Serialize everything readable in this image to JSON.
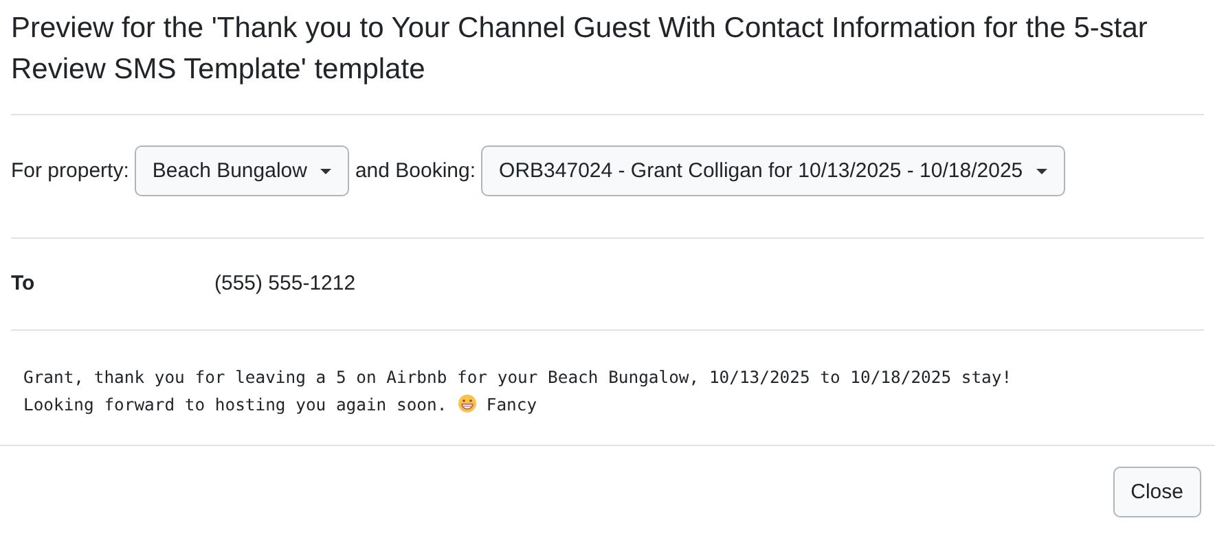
{
  "title": "Preview for the 'Thank you to Your Channel Guest With Contact Information for the 5-star Review SMS Template' template",
  "filters": [
    {
      "label": "For property:",
      "value": "Beach Bungalow"
    },
    {
      "label": "and Booking:",
      "value": "ORB347024 - Grant Colligan for 10/13/2025 - 10/18/2025"
    }
  ],
  "to": {
    "label": "To",
    "value": "(555) 555-1212"
  },
  "message": {
    "line_1": "Grant, thank you for leaving a 5 on Airbnb for your Beach Bungalow, 10/13/2025 to 10/18/2025 stay!",
    "line_2_before": "Looking forward to hosting you again soon.",
    "line_2_after": "Fancy"
  },
  "buttons": [
    "Close"
  ]
}
